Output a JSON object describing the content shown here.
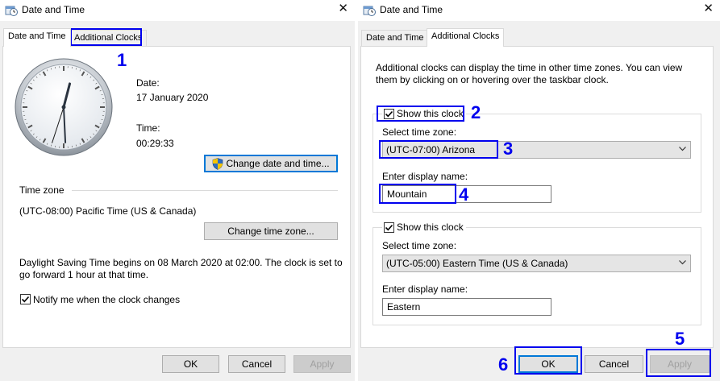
{
  "left_dialog": {
    "title": "Date and Time",
    "close_glyph": "✕",
    "tabs": [
      {
        "label": "Date and Time",
        "active": true
      },
      {
        "label": "Additional Clocks",
        "active": false
      }
    ],
    "date_label": "Date:",
    "date_value": "17 January 2020",
    "time_label": "Time:",
    "time_value": "00:29:33",
    "change_datetime_button": "Change date and time...",
    "timezone_section_label": "Time zone",
    "timezone_value": "(UTC-08:00) Pacific Time (US & Canada)",
    "change_timezone_button": "Change time zone...",
    "dst_text_line1": "Daylight Saving Time begins on 08 March 2020 at 02:00. The clock is set to",
    "dst_text_line2": "go forward 1 hour at that time.",
    "notify_checkbox_label": "Notify me when the clock changes",
    "notify_checked": true,
    "buttons": {
      "ok": "OK",
      "cancel": "Cancel",
      "apply": "Apply"
    }
  },
  "right_dialog": {
    "title": "Date and Time",
    "close_glyph": "✕",
    "tabs": [
      {
        "label": "Date and Time",
        "active": false
      },
      {
        "label": "Additional Clocks",
        "active": true
      }
    ],
    "intro_line1": "Additional clocks can display the time in other time zones. You can view",
    "intro_line2": "them by clicking on or hovering over the taskbar clock.",
    "clock1": {
      "show_label": "Show this clock",
      "checked": true,
      "timezone_label": "Select time zone:",
      "timezone_value": "(UTC-07:00) Arizona",
      "display_name_label": "Enter display name:",
      "display_name_value": "Mountain"
    },
    "clock2": {
      "show_label": "Show this clock",
      "checked": true,
      "timezone_label": "Select time zone:",
      "timezone_value": "(UTC-05:00) Eastern Time (US & Canada)",
      "display_name_label": "Enter display name:",
      "display_name_value": "Eastern"
    },
    "buttons": {
      "ok": "OK",
      "cancel": "Cancel",
      "apply": "Apply"
    }
  },
  "annotations": {
    "n1": "1",
    "n2": "2",
    "n3": "3",
    "n4": "4",
    "n5": "5",
    "n6": "6",
    "color": "#0000ee"
  },
  "clock_face": {
    "hour": 0,
    "minute": 29,
    "second": 33
  }
}
